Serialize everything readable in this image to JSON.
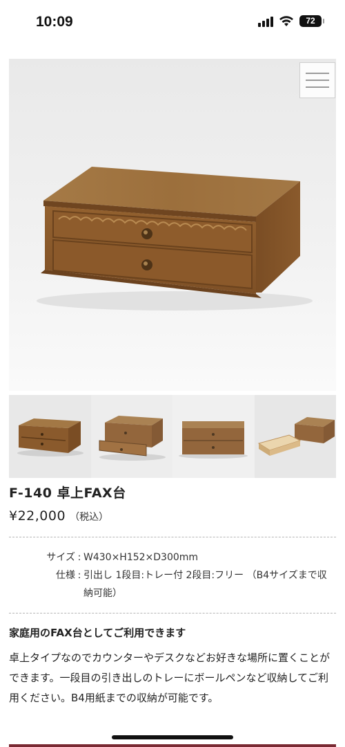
{
  "status_bar": {
    "time": "10:09",
    "battery": "72",
    "icons": [
      "signal-icon",
      "wifi-icon",
      "battery-icon"
    ]
  },
  "hero": {
    "image": "wooden-fax-stand-two-drawers",
    "menu_icon": "hamburger-menu-icon"
  },
  "thumbnails": [
    {
      "image": "fax-stand-closed"
    },
    {
      "image": "fax-stand-drawer-open"
    },
    {
      "image": "fax-stand-front"
    },
    {
      "image": "fax-stand-tray-out"
    }
  ],
  "product": {
    "title": "F-140 卓上FAX台",
    "price": "¥22,000",
    "tax_note": "（税込）"
  },
  "specs": [
    {
      "label": "サイズ",
      "value": "W430×H152×D300mm"
    },
    {
      "label": "仕様",
      "value": "引出し 1段目:トレー付 2段目:フリー （B4サイズまで収納可能）"
    }
  ],
  "description": {
    "title": "家庭用のFAX台としてご利用できます",
    "body": "卓上タイプなのでカウンターやデスクなどお好きな場所に置くことができます。一段目の引き出しのトレーにボールペンなど収納してご利用ください。B4用紙までの収納が可能です。"
  },
  "colors": {
    "accent": "#7a2a33",
    "wood": "#8a5a2c"
  }
}
